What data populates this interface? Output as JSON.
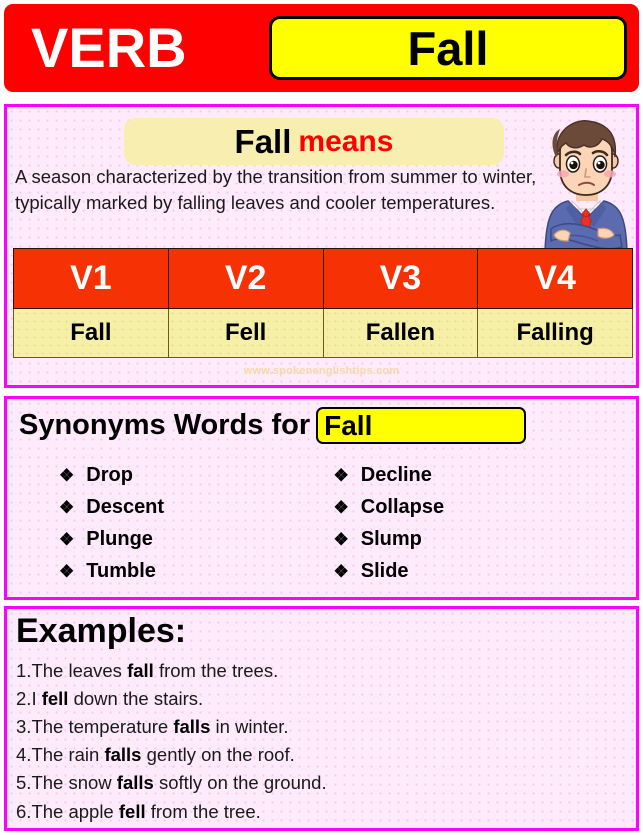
{
  "header": {
    "category_label": "VERB",
    "word": "Fall"
  },
  "meaning": {
    "box_word": "Fall",
    "box_suffix": "means",
    "definition": "A season characterized by the transition from summer to winter, typically marked by falling leaves and cooler temperatures.",
    "illustration": "confused-man-illustration"
  },
  "verb_table": {
    "headers": [
      "V1",
      "V2",
      "V3",
      "V4"
    ],
    "values": [
      "Fall",
      "Fell",
      "Fallen",
      "Falling"
    ]
  },
  "watermark": "www.spokenenglishtips.com",
  "synonyms": {
    "title": "Synonyms Words for",
    "word": "Fall",
    "bullet_glyph": "❖",
    "left_column": [
      "Drop",
      "Descent",
      "Plunge",
      "Tumble"
    ],
    "right_column": [
      "Decline",
      "Collapse",
      "Slump",
      "Slide"
    ]
  },
  "examples": {
    "title": "Examples:",
    "items": [
      {
        "num": "1.",
        "pre": "The leaves ",
        "bold": "fall",
        "post": " from the trees."
      },
      {
        "num": "2.",
        "pre": "I ",
        "bold": "fell",
        "post": " down the stairs."
      },
      {
        "num": "3.",
        "pre": "The temperature ",
        "bold": "falls",
        "post": " in winter."
      },
      {
        "num": "4.",
        "pre": "The rain ",
        "bold": "falls",
        "post": " gently on the roof."
      },
      {
        "num": "5.",
        "pre": "The snow ",
        "bold": "falls",
        "post": " softly on the ground."
      },
      {
        "num": "6.",
        "pre": "The apple ",
        "bold": "fell",
        "post": " from the tree."
      }
    ]
  },
  "colors": {
    "banner_red": "#ff0000",
    "table_header_red": "#f63205",
    "highlight_yellow": "#ffff00",
    "cell_yellow": "#f5efa8",
    "border_magenta": "#ff00ff",
    "background_pink": "#fdeafb"
  }
}
